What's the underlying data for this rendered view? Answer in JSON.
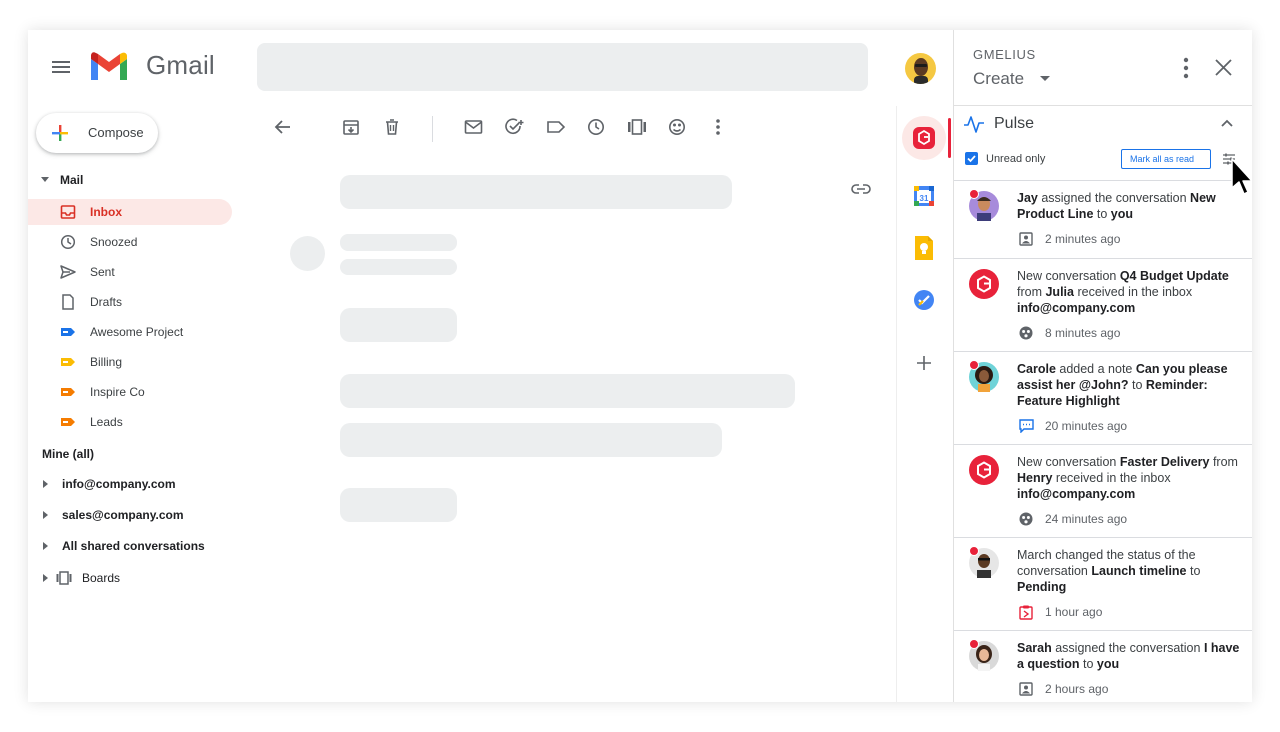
{
  "app": {
    "name": "Gmail"
  },
  "compose": {
    "label": "Compose"
  },
  "sidebar": {
    "mail_section": "Mail",
    "items": [
      {
        "label": "Inbox"
      },
      {
        "label": "Snoozed"
      },
      {
        "label": "Sent"
      },
      {
        "label": "Drafts"
      },
      {
        "label": "Awesome Project"
      },
      {
        "label": "Billing"
      },
      {
        "label": "Inspire Co"
      },
      {
        "label": "Leads"
      }
    ],
    "mine_section": "Mine (all)",
    "accounts": [
      {
        "label": "info@company.com"
      },
      {
        "label": "sales@company.com"
      },
      {
        "label": "All shared conversations"
      }
    ],
    "boards": "Boards"
  },
  "colors": {
    "accent_red": "#d93025",
    "gmelius_red": "#e8223a",
    "link_blue": "#1a73e8"
  },
  "panel": {
    "brand": "GMELIUS",
    "create_label": "Create",
    "pulse": {
      "title": "Pulse",
      "unread_only_label": "Unread only",
      "unread_only_checked": true,
      "mark_all_label": "Mark all as read"
    },
    "notifications": [
      {
        "parts": [
          {
            "t": "Jay",
            "b": true
          },
          {
            "t": " assigned the conversation ",
            "b": false
          },
          {
            "t": "New Product Line",
            "b": true
          },
          {
            "t": " to ",
            "b": false
          },
          {
            "t": "you",
            "b": true
          }
        ],
        "time": "2 minutes ago",
        "icon": "assign-icon",
        "avatar": "avatar-jay",
        "unread": true
      },
      {
        "parts": [
          {
            "t": "New conversation ",
            "b": false
          },
          {
            "t": "Q4 Budget Update",
            "b": true
          },
          {
            "t": " from ",
            "b": false
          },
          {
            "t": "Julia",
            "b": true
          },
          {
            "t": " received in the inbox ",
            "b": false
          },
          {
            "t": "info@company.com",
            "b": true
          }
        ],
        "time": "8 minutes ago",
        "icon": "shared-inbox-icon",
        "avatar": "gmelius-logo",
        "unread": false
      },
      {
        "parts": [
          {
            "t": "Carole",
            "b": true
          },
          {
            "t": " added a note ",
            "b": false
          },
          {
            "t": "Can you please assist her @John?",
            "b": true
          },
          {
            "t": " to ",
            "b": false
          },
          {
            "t": "Reminder: Feature Highlight",
            "b": true
          }
        ],
        "time": "20 minutes ago",
        "icon": "note-icon",
        "avatar": "avatar-carole",
        "unread": true
      },
      {
        "parts": [
          {
            "t": "New conversation ",
            "b": false
          },
          {
            "t": "Faster Delivery",
            "b": true
          },
          {
            "t": " from ",
            "b": false
          },
          {
            "t": "Henry",
            "b": true
          },
          {
            "t": " received in the inbox ",
            "b": false
          },
          {
            "t": "info@company.com",
            "b": true
          }
        ],
        "time": "24 minutes ago",
        "icon": "shared-inbox-icon",
        "avatar": "gmelius-logo",
        "unread": false
      },
      {
        "parts": [
          {
            "t": "March changed the status of the conversation ",
            "b": false
          },
          {
            "t": "Launch timeline",
            "b": true
          },
          {
            "t": " to ",
            "b": false
          },
          {
            "t": "Pending",
            "b": true
          }
        ],
        "time": "1 hour ago",
        "icon": "status-icon",
        "avatar": "avatar-march",
        "unread": true
      },
      {
        "parts": [
          {
            "t": "Sarah",
            "b": true
          },
          {
            "t": " assigned the conversation ",
            "b": false
          },
          {
            "t": "I have a question",
            "b": true
          },
          {
            "t": " to ",
            "b": false
          },
          {
            "t": "you",
            "b": true
          }
        ],
        "time": "2 hours ago",
        "icon": "assign-icon",
        "avatar": "avatar-sarah",
        "unread": true
      }
    ]
  }
}
